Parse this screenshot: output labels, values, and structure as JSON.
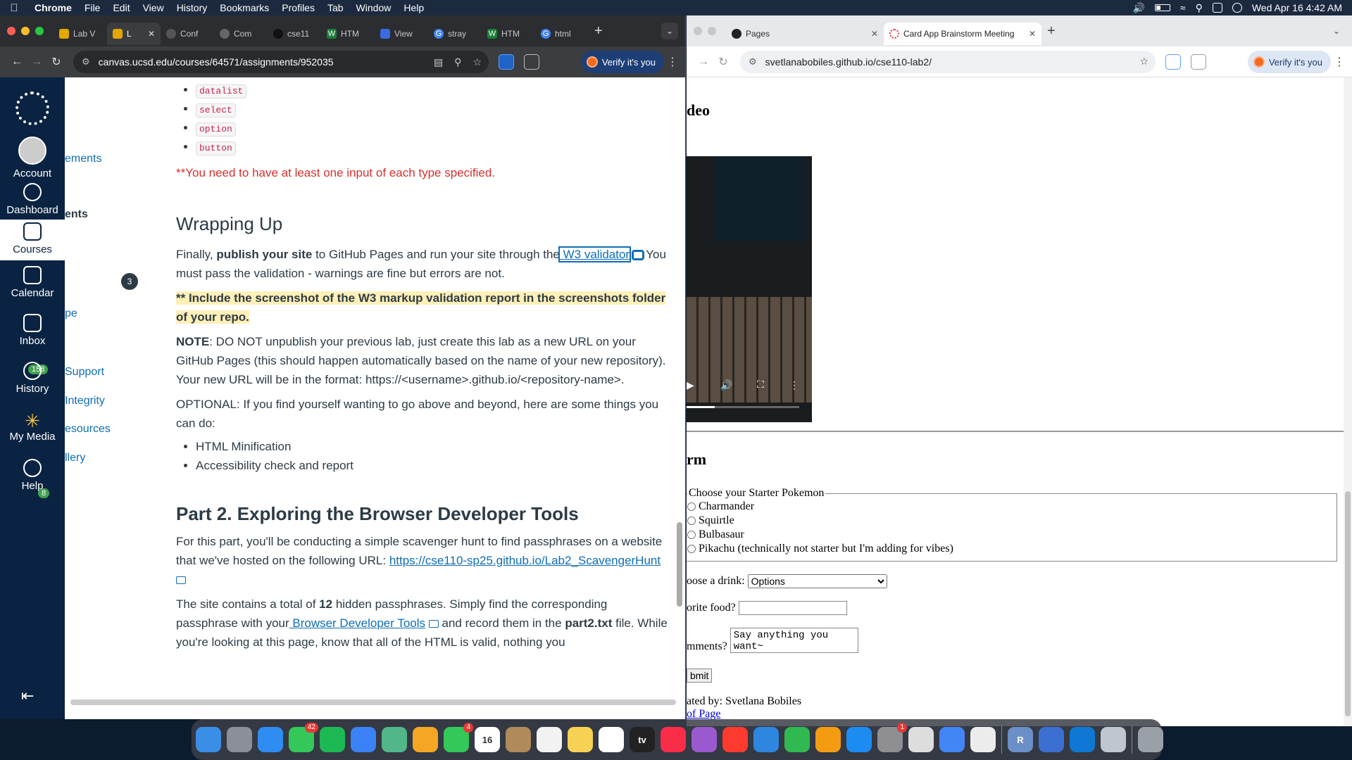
{
  "menubar": {
    "app": "Chrome",
    "menus": [
      "File",
      "Edit",
      "View",
      "History",
      "Bookmarks",
      "Profiles",
      "Tab",
      "Window",
      "Help"
    ],
    "datetime": "Wed Apr 16  4:42 AM"
  },
  "left_window": {
    "tabs": [
      {
        "label": "Lab V",
        "color": "#e0a800"
      },
      {
        "label": "L",
        "color": "#e0a800",
        "active": true
      },
      {
        "label": "Conf",
        "color": "#666"
      },
      {
        "label": "Com",
        "color": "#666"
      },
      {
        "label": "cse11",
        "color": "#222"
      },
      {
        "label": "HTM",
        "color": "#1a7f37"
      },
      {
        "label": "View",
        "color": "#3b6be0"
      },
      {
        "label": "stray",
        "color": "#4285f4"
      },
      {
        "label": "HTM",
        "color": "#1a7f37"
      },
      {
        "label": "html",
        "color": "#4285f4"
      }
    ],
    "url": "canvas.ucsd.edu/courses/64571/assignments/952035",
    "verify_label": "Verify it's you",
    "global_nav": {
      "account": "Account",
      "dashboard": "Dashboard",
      "courses": "Courses",
      "calendar": "Calendar",
      "inbox": "Inbox",
      "inbox_badge": "158",
      "history": "History",
      "my_media": "My Media",
      "help": "Help",
      "help_badge": "8"
    },
    "course_nav": {
      "items": [
        "ements",
        "ents",
        "pe",
        "Support",
        "Integrity",
        "esources",
        "llery"
      ],
      "count": "3"
    },
    "content": {
      "code_items": [
        "datalist",
        "select",
        "option",
        "button"
      ],
      "warning": "**You need to have at least one input of each type specified.",
      "wrapping_heading": "Wrapping Up",
      "p1_a": "Finally, ",
      "p1_bold": "publish your site",
      "p1_b": " to GitHub Pages and run your site through the",
      "p1_link": " W3 validator",
      "p1_c": " You must pass the validation - warnings are fine but errors are not.",
      "highlight": "** Include the screenshot of the W3 markup validation report in the screenshots folder of your repo.",
      "note_label": "NOTE",
      "note_text": ": DO NOT unpublish your previous lab, just create this lab as a new URL on your GitHub Pages (this should happen automatically based on the name of your new repository). Your new URL will be in the format: https://<username>.github.io/<repository-name>.",
      "optional": "OPTIONAL: If you find yourself wanting to go above and beyond, here are some things you can do:",
      "optional_items": [
        "HTML Minification",
        "Accessibility check and report"
      ],
      "part2_heading": "Part 2. Exploring the Browser Developer Tools",
      "part2_p": "For this part, you'll be conducting a simple scavenger hunt to find passphrases on a website that we've hosted on the following URL: ",
      "part2_link": "https://cse110-sp25.github.io/Lab2_ScavengerHunt",
      "p3_a": "The site contains a total of ",
      "p3_bold": "12",
      "p3_b": " hidden passphrases. Simply find the corresponding passphrase with your",
      "p3_link": " Browser Developer Tools",
      "p3_c": " and record them in the ",
      "p3_bold2": "part2.txt",
      "p3_d": " file. While you're looking at this page, know that all of the HTML is valid, nothing you"
    }
  },
  "right_window": {
    "tabs": [
      {
        "label": "Pages"
      },
      {
        "label": "Card App Brainstorm Meeting",
        "active": true
      }
    ],
    "url": "svetlanabobiles.github.io/cse110-lab2/",
    "verify_label": "Verify it's you",
    "page": {
      "video_heading": "deo",
      "form_heading": "rm",
      "legend": "Choose your Starter Pokemon",
      "radios": [
        "Charmander",
        "Squirtle",
        "Bulbasaur",
        "Pikachu (technically not starter but I'm adding for vibes)"
      ],
      "drink_label": "oose a drink:",
      "drink_selected": "Options",
      "food_label": "orite food?",
      "comments_label": "mments?",
      "comments_value": "Say anything you want~",
      "submit_label": "bmit",
      "created_by": "ated by: Svetlana Bobiles",
      "top_link": "of Page"
    }
  },
  "dock": {
    "apps": [
      {
        "name": "finder",
        "color": "#3a8ee6"
      },
      {
        "name": "launchpad",
        "color": "#8a8f98"
      },
      {
        "name": "safari",
        "color": "#2f8cf0"
      },
      {
        "name": "messages",
        "color": "#34c759",
        "badge": "42"
      },
      {
        "name": "spotify",
        "color": "#1db954"
      },
      {
        "name": "mail",
        "color": "#3b82f6"
      },
      {
        "name": "maps",
        "color": "#52b788"
      },
      {
        "name": "photos",
        "color": "#f5a623"
      },
      {
        "name": "facetime",
        "color": "#34c759",
        "badge": "4"
      },
      {
        "name": "calendar",
        "color": "#ffffff",
        "label": "16"
      },
      {
        "name": "contacts",
        "color": "#b08a5a"
      },
      {
        "name": "reminders",
        "color": "#f2f2f2"
      },
      {
        "name": "notes",
        "color": "#f7d154"
      },
      {
        "name": "freeform",
        "color": "#ffffff"
      },
      {
        "name": "tv",
        "color": "#222222",
        "label": "tv"
      },
      {
        "name": "music",
        "color": "#fa2d48"
      },
      {
        "name": "podcasts",
        "color": "#9b59d0"
      },
      {
        "name": "news",
        "color": "#ff3b30"
      },
      {
        "name": "keynote",
        "color": "#2e86de"
      },
      {
        "name": "numbers",
        "color": "#30b950"
      },
      {
        "name": "pages",
        "color": "#f39c12"
      },
      {
        "name": "app-store",
        "color": "#1c8cf2"
      },
      {
        "name": "system-settings",
        "color": "#8e8e93",
        "badge": "1"
      },
      {
        "name": "preview",
        "color": "#dddddd"
      },
      {
        "name": "chrome",
        "color": "#4285f4"
      },
      {
        "name": "xcode-tools",
        "color": "#ececec"
      },
      {
        "name": "r",
        "color": "#6b8fc7",
        "label": "R"
      },
      {
        "name": "quicktime",
        "color": "#3b6fd1"
      },
      {
        "name": "vscode",
        "color": "#0e78d4"
      },
      {
        "name": "simulator",
        "color": "#c0c6d0"
      },
      {
        "name": "trash",
        "color": "#9aa0a8"
      }
    ]
  }
}
